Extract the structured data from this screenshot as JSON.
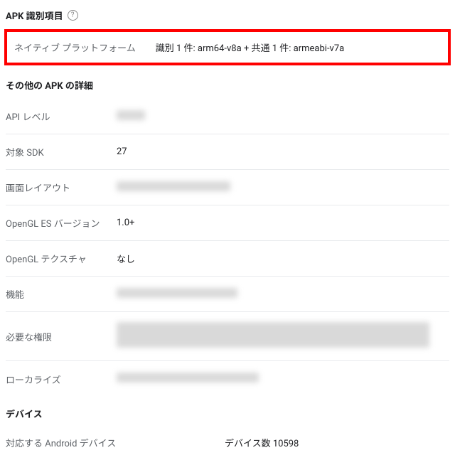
{
  "header": {
    "title": "APK 識別項目"
  },
  "highlighted": {
    "label": "ネイティブ プラットフォーム",
    "value": "識別 1 件: arm64-v8a + 共通 1 件: armeabi-v7a"
  },
  "other_details": {
    "title": "その他の APK の詳細",
    "rows": {
      "api_level": {
        "label": "API レベル"
      },
      "target_sdk": {
        "label": "対象 SDK",
        "value": "27"
      },
      "screen_layout": {
        "label": "画面レイアウト"
      },
      "opengl_es": {
        "label": "OpenGL ES バージョン",
        "value": "1.0+"
      },
      "opengl_texture": {
        "label": "OpenGL テクスチャ",
        "value": "なし"
      },
      "features": {
        "label": "機能"
      },
      "permissions": {
        "label": "必要な権限"
      },
      "localization": {
        "label": "ローカライズ"
      }
    }
  },
  "device": {
    "title": "デバイス",
    "supported_label": "対応する Android デバイス",
    "supported_value": "デバイス数 10598"
  }
}
